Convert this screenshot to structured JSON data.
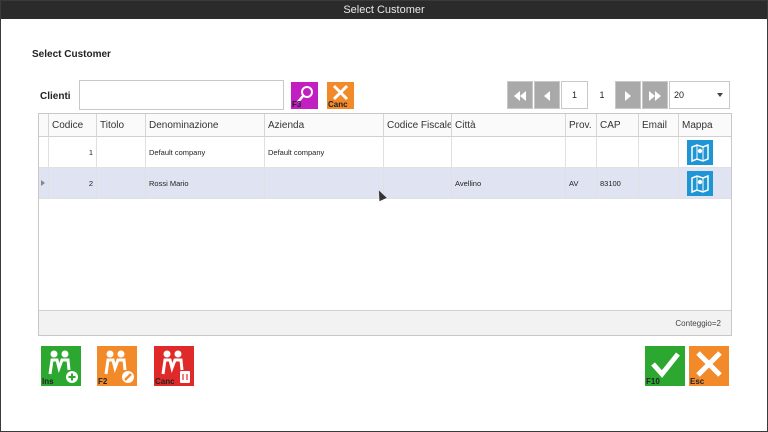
{
  "window": {
    "title": "Select Customer"
  },
  "heading": "Select Customer",
  "search": {
    "label": "Clienti",
    "value": "",
    "search_key": "F3",
    "clear_key": "Canc"
  },
  "pager": {
    "current_page": "1",
    "total_pages": "1",
    "page_size": "20"
  },
  "grid": {
    "columns": [
      "Codice",
      "Titolo",
      "Denominazione",
      "Azienda",
      "Codice Fiscale",
      "Città",
      "Prov.",
      "CAP",
      "Email",
      "Mappa"
    ],
    "rows": [
      {
        "codice": "1",
        "titolo": "",
        "denominazione": "Default company",
        "azienda": "Default company",
        "codice_fiscale": "",
        "citta": "",
        "prov": "",
        "cap": "",
        "email": ""
      },
      {
        "codice": "2",
        "titolo": "",
        "denominazione": "Rossi Mario",
        "azienda": "",
        "codice_fiscale": "",
        "citta": "Avellino",
        "prov": "AV",
        "cap": "83100",
        "email": ""
      }
    ],
    "footer": "Conteggio=2"
  },
  "actions": {
    "insert_key": "Ins",
    "edit_key": "F2",
    "delete_key": "Canc",
    "confirm_key": "F10",
    "escape_key": "Esc"
  },
  "icons": {
    "search": "search-icon",
    "clear": "close-icon",
    "map": "map-icon",
    "first": "first-page-icon",
    "prev": "prev-page-icon",
    "next": "next-page-icon",
    "last": "last-page-icon",
    "add_user": "add-user-icon",
    "edit_user": "edit-user-icon",
    "delete_user": "delete-user-icon",
    "confirm": "checkmark-icon",
    "cancel": "close-icon"
  },
  "colors": {
    "title_bar": "#2b2b2b",
    "search_button": "#c21fc2",
    "orange": "#f28a2a",
    "green": "#2ca830",
    "red": "#e02a2a",
    "map_button": "#1e95d4",
    "selected_row": "#e0e4f2"
  }
}
